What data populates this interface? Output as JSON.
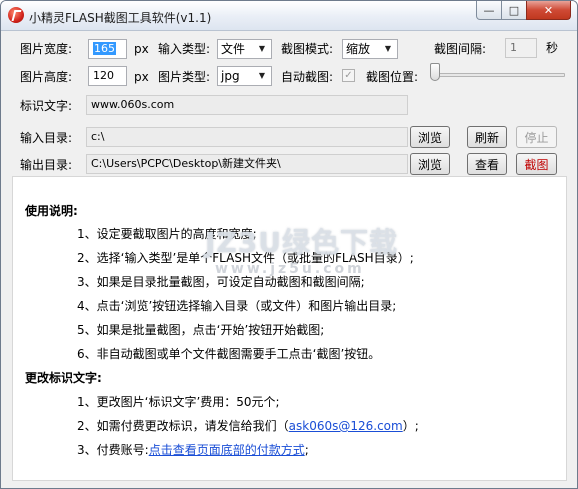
{
  "window": {
    "title": "小精灵FLASH截图工具软件(v1.1)",
    "controls": {
      "minimize": "—",
      "maximize": "□",
      "close": "✕"
    }
  },
  "form": {
    "width_label": "图片宽度:",
    "width_value": "165",
    "width_unit": "px",
    "height_label": "图片高度:",
    "height_value": "120",
    "height_unit": "px",
    "input_type_label": "输入类型:",
    "input_type_value": "文件",
    "capture_mode_label": "截图模式:",
    "capture_mode_value": "缩放",
    "interval_label": "截图间隔:",
    "interval_value": "1",
    "interval_unit": "秒",
    "image_type_label": "图片类型:",
    "image_type_value": "jpg",
    "auto_capture_label": "自动截图:",
    "auto_capture_checked": true,
    "capture_position_label": "截图位置:",
    "capture_position_level": 0,
    "watermark_label": "标识文字:",
    "watermark_value": "www.060s.com",
    "input_dir_label": "输入目录:",
    "input_dir_value": "c:\\",
    "output_dir_label": "输出目录:",
    "output_dir_value": "C:\\Users\\PCPC\\Desktop\\新建文件夹\\"
  },
  "buttons": {
    "browse_input": "浏览",
    "refresh": "刷新",
    "stop": "停止",
    "browse_output": "浏览",
    "view": "查看",
    "capture": "截图"
  },
  "help": {
    "usage_title": "使用说明:",
    "usage_items": [
      "1、设定要截取图片的高度和宽度;",
      "2、选择‘输入类型’是单个FLASH文件（或批量的FLASH目录）;",
      "3、如果是目录批量截图，可设定自动截图和截图间隔;",
      "4、点击‘浏览’按钮选择输入目录（或文件）和图片输出目录;",
      "5、如果是批量截图，点击‘开始’按钮开始截图;",
      "6、非自动截图或单个文件截图需要手工点击‘截图’按钮。"
    ],
    "change_title": "更改标识文字:",
    "change_item1": "1、更改图片‘标识文字’费用：50元个;",
    "change_item2_prefix": "2、如需付费更改标识，请发信给我们（",
    "change_item2_link": "ask060s@126.com",
    "change_item2_suffix": "）;",
    "change_item3_prefix": "3、付费账号:",
    "change_item3_link": "点击查看页面底部的付款方式",
    "change_item3_suffix": ";"
  },
  "watermark_overlay": {
    "main": "JZ3U绿色下载",
    "sub": "www.jz5u.com"
  }
}
